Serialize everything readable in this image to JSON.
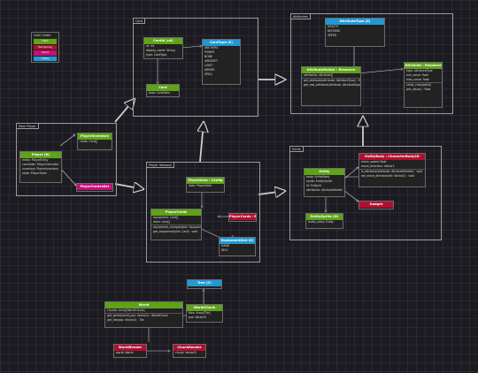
{
  "legend": {
    "title": "Color Codes",
    "items": [
      {
        "label": "Data",
        "color": "#5ea318"
      },
      {
        "label": "Rendering",
        "color": "#b0102f"
      },
      {
        "label": "Input",
        "color": "#c4107a"
      },
      {
        "label": "Utility",
        "color": "#1f9ad6"
      }
    ]
  },
  "groups": {
    "card": "Card",
    "attributes": "Attributes",
    "main_player": "Main Player",
    "player_hotbank": "Player Hotbank",
    "entity": "Entity"
  },
  "classes": {
    "card_id": {
      "name": "CardId (u8)",
      "rows": [
        "id: Int"
      ]
    },
    "card_data": {
      "name": "CardData",
      "rows": [
        "display_name: String",
        "type: CardType"
      ]
    },
    "card_type": {
      "name": "CardType (E)",
      "rows": [
        "ANCHORS",
        "POWER",
        "NONE",
        "AIRCRAFT",
        "LIGHT",
        "ARMOR",
        "SPELL"
      ]
    },
    "card": {
      "name": "Card",
      "rows": [
        "data: CardData"
      ]
    },
    "attribute_type": {
      "name": "AttributeType (E)",
      "rows": [
        "HEALTH",
        "DEFENSE",
        "SPEED"
      ]
    },
    "attribute_holder": {
      "name": "AttributeHolder : Resource",
      "rows": [
        "attributes: Attribute[]",
        "get_attribute(attribute: AttributeType) : float",
        "get_raw_attribute(attribute: AttributeType) : Attribute"
      ]
    },
    "attribute": {
      "name": "Attribute : Resource",
      "rows": [
        "type: AttributeType",
        "min_value: float",
        "max_value: float",
        "value_changed(#)",
        "get_value() : float"
      ]
    },
    "player": {
      "name": "Player (N)",
      "rows": [
        "entity: PlayerEntity",
        "controller: PlayerController",
        "inventory: PlayerInventory",
        "state: PlayerState"
      ]
    },
    "player_inventory": {
      "name": "PlayerInventory",
      "rows": [
        "cards: Card[]"
      ]
    },
    "player_controller": {
      "name": "PlayerController",
      "rows": []
    },
    "player_data": {
      "name": "PlayerData : Config",
      "rows": [
        "data: PlayerData"
      ]
    },
    "player_cards": {
      "name": "PlayerCards",
      "rows": [
        "equipment: Card[]",
        "deck: Card[]",
        "equipment_changed(slot: EquipmentSlot)",
        "get_equipment(slot: Card) : void"
      ]
    },
    "player_cards_render": {
      "name": "PlayerCards : EntitySprite",
      "rows": []
    },
    "equipment_slot": {
      "name": "EquipmentSlot (E)",
      "rows": [
        "HAND",
        "IDOL"
      ]
    },
    "entity_body": {
      "name": "EntityBody : CharacterBody2D",
      "rows": [
        "move_speed: float",
        "move_direction: Vector2",
        "is_attribute(attribute: AttributeHolder) : void",
        "set_move_direction(dir: Vector2) : void"
      ]
    },
    "entity": {
      "name": "Entity",
      "rows": [
        "body: EntityBody",
        "sprite: EntitySprite",
        "id: EntityId",
        "attributes: AttributeHolder"
      ]
    },
    "entity_sprite": {
      "name": "EntitySprite (N)",
      "rows": [
        "entity_body: Entity"
      ]
    },
    "gadget": {
      "name": "Gadget",
      "rows": []
    },
    "tree": {
      "name": "Tree (C)",
      "rows": []
    },
    "world": {
      "name": "World",
      "rows": [
        "chunks: Array[WorldChunk]",
        "get_world(world_pos: Vector2) : WorldChunk",
        "get_tile(pos: Vector2) : Tile"
      ]
    },
    "world_chunk": {
      "name": "WorldChunk",
      "rows": [
        "tiles: Array[Tile]",
        "pos: Vector2i"
      ]
    },
    "world_render": {
      "name": "WorldRender",
      "rows": [
        "world: World"
      ]
    },
    "chunk_render": {
      "name": "ChunkRender",
      "rows": [
        "chunk: Vector2i"
      ]
    }
  }
}
